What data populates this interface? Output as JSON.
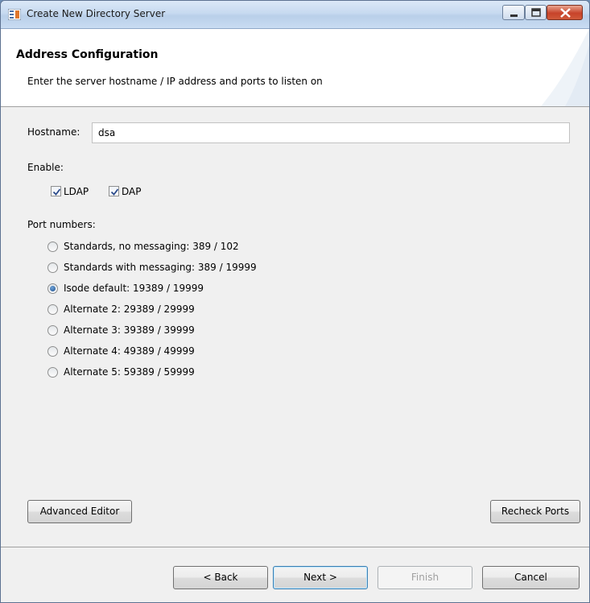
{
  "window": {
    "title": "Create New Directory Server"
  },
  "banner": {
    "title": "Address Configuration",
    "description": "Enter the server hostname / IP address and ports to listen on"
  },
  "hostname": {
    "label": "Hostname:",
    "value": "dsa"
  },
  "enable": {
    "label": "Enable:",
    "options": [
      {
        "label": "LDAP",
        "checked": true
      },
      {
        "label": "DAP",
        "checked": true
      }
    ]
  },
  "ports": {
    "label": "Port numbers:",
    "selected_index": 2,
    "options": [
      "Standards, no messaging: 389 / 102",
      "Standards with messaging: 389 / 19999",
      "Isode default: 19389 / 19999",
      "Alternate 2: 29389 / 29999",
      "Alternate 3: 39389 / 39999",
      "Alternate 4: 49389 / 49999",
      "Alternate 5: 59389 / 59999"
    ]
  },
  "actions": {
    "advanced_editor": "Advanced Editor",
    "recheck_ports": "Recheck Ports"
  },
  "footer": {
    "back": "< Back",
    "next": "Next >",
    "finish": "Finish",
    "cancel": "Cancel"
  },
  "colors": {
    "accent": "#3c7fb1",
    "selected_radio": "#1c4e8a",
    "titlebar": "#c7daf0"
  }
}
